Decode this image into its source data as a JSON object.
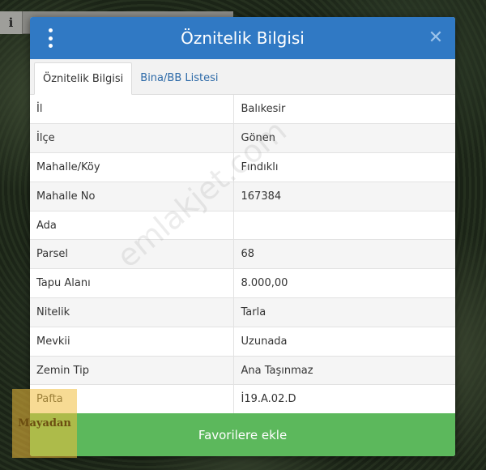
{
  "map": {
    "info_icon": "i"
  },
  "modal": {
    "title": "Öznitelik Bilgisi",
    "close_icon": "✕",
    "tabs": [
      {
        "label": "Öznitelik Bilgisi",
        "active": true
      },
      {
        "label": "Bina/BB Listesi",
        "active": false
      }
    ],
    "rows": [
      {
        "key": "İl",
        "value": "Balıkesir"
      },
      {
        "key": "İlçe",
        "value": "Gönen"
      },
      {
        "key": "Mahalle/Köy",
        "value": "Fındıklı"
      },
      {
        "key": "Mahalle No",
        "value": "167384"
      },
      {
        "key": "Ada",
        "value": ""
      },
      {
        "key": "Parsel",
        "value": "68"
      },
      {
        "key": "Tapu Alanı",
        "value": "8.000,00"
      },
      {
        "key": "Nitelik",
        "value": "Tarla"
      },
      {
        "key": "Mevkii",
        "value": "Uzunada"
      },
      {
        "key": "Zemin Tip",
        "value": "Ana Taşınmaz"
      },
      {
        "key": "Pafta",
        "value": "İ19.A.02.D"
      }
    ],
    "favorite_button": "Favorilere ekle"
  },
  "watermark": "emlakjet.com",
  "brand": "Mayadan",
  "colors": {
    "header": "#3079c4",
    "button": "#5cb85c",
    "tab_link": "#2d6aa8"
  }
}
